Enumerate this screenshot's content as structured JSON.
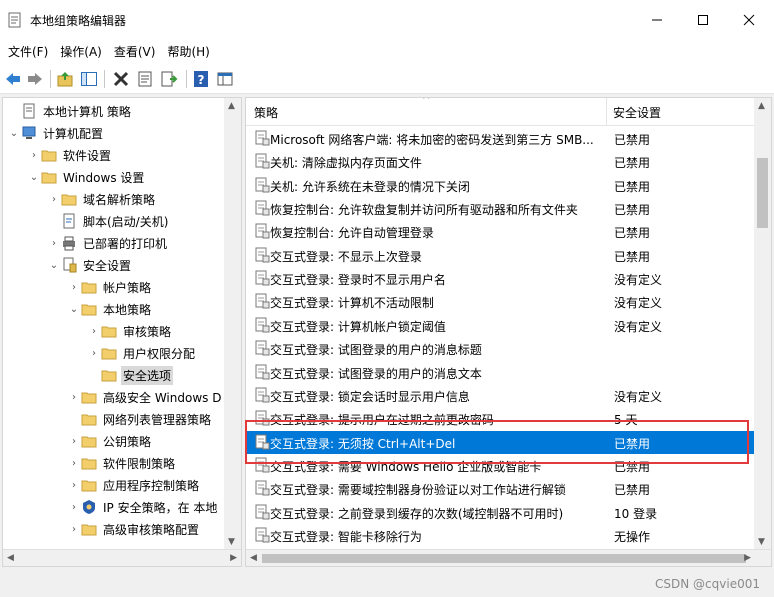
{
  "window": {
    "title": "本地组策略编辑器",
    "icon": "policy-editor-icon"
  },
  "menu": [
    "文件(F)",
    "操作(A)",
    "查看(V)",
    "帮助(H)"
  ],
  "toolbar_icons": [
    "back-arrow-icon",
    "forward-arrow-icon",
    "up-folder-icon",
    "show-hide-tree-icon",
    "delete-icon",
    "properties-icon",
    "export-list-icon",
    "help-icon",
    "view-icon"
  ],
  "tree": [
    {
      "label": "本地计算机 策略",
      "icon": "policy-doc-icon",
      "arrow": ""
    },
    {
      "label": "计算机配置",
      "icon": "computer-icon",
      "arrow": "⌄"
    },
    {
      "label": "软件设置",
      "icon": "folder-icon",
      "arrow": "›"
    },
    {
      "label": "Windows 设置",
      "icon": "folder-icon",
      "arrow": "⌄"
    },
    {
      "label": "域名解析策略",
      "icon": "folder-icon",
      "arrow": "›"
    },
    {
      "label": "脚本(启动/关机)",
      "icon": "script-icon",
      "arrow": ""
    },
    {
      "label": "已部署的打印机",
      "icon": "printer-icon",
      "arrow": "›"
    },
    {
      "label": "安全设置",
      "icon": "security-icon",
      "arrow": "⌄"
    },
    {
      "label": "帐户策略",
      "icon": "folder-icon",
      "arrow": "›"
    },
    {
      "label": "本地策略",
      "icon": "folder-icon",
      "arrow": "⌄"
    },
    {
      "label": "审核策略",
      "icon": "folder-icon",
      "arrow": "›"
    },
    {
      "label": "用户权限分配",
      "icon": "folder-icon",
      "arrow": "›"
    },
    {
      "label": "安全选项",
      "icon": "folder-icon",
      "arrow": ""
    },
    {
      "label": "高级安全 Windows D",
      "icon": "folder-icon",
      "arrow": "›"
    },
    {
      "label": "网络列表管理器策略",
      "icon": "folder-icon",
      "arrow": ""
    },
    {
      "label": "公钥策略",
      "icon": "folder-icon",
      "arrow": "›"
    },
    {
      "label": "软件限制策略",
      "icon": "folder-icon",
      "arrow": "›"
    },
    {
      "label": "应用程序控制策略",
      "icon": "folder-icon",
      "arrow": "›"
    },
    {
      "label": "IP 安全策略，在 本地",
      "icon": "ip-security-icon",
      "arrow": "›"
    },
    {
      "label": "高级审核策略配置",
      "icon": "folder-icon",
      "arrow": "›"
    }
  ],
  "tree_selected": "安全选项",
  "columns": {
    "policy": "策略",
    "setting": "安全设置"
  },
  "rows": [
    {
      "name": "Microsoft 网络客户端: 将未加密的密码发送到第三方 SMB...",
      "value": "已禁用"
    },
    {
      "name": "关机: 清除虚拟内存页面文件",
      "value": "已禁用"
    },
    {
      "name": "关机: 允许系统在未登录的情况下关闭",
      "value": "已禁用"
    },
    {
      "name": "恢复控制台: 允许软盘复制并访问所有驱动器和所有文件夹",
      "value": "已禁用"
    },
    {
      "name": "恢复控制台: 允许自动管理登录",
      "value": "已禁用"
    },
    {
      "name": "交互式登录: 不显示上次登录",
      "value": "已禁用"
    },
    {
      "name": "交互式登录: 登录时不显示用户名",
      "value": "没有定义"
    },
    {
      "name": "交互式登录: 计算机不活动限制",
      "value": "没有定义"
    },
    {
      "name": "交互式登录: 计算机帐户锁定阈值",
      "value": "没有定义"
    },
    {
      "name": "交互式登录: 试图登录的用户的消息标题",
      "value": ""
    },
    {
      "name": "交互式登录: 试图登录的用户的消息文本",
      "value": ""
    },
    {
      "name": "交互式登录: 锁定会话时显示用户信息",
      "value": "没有定义"
    },
    {
      "name": "交互式登录: 提示用户在过期之前更改密码",
      "value": "5 天"
    },
    {
      "name": "交互式登录: 无须按 Ctrl+Alt+Del",
      "value": "已禁用"
    },
    {
      "name": "交互式登录: 需要 Windows Hello 企业版或智能卡",
      "value": "已禁用"
    },
    {
      "name": "交互式登录: 需要域控制器身份验证以对工作站进行解锁",
      "value": "已禁用"
    },
    {
      "name": "交互式登录: 之前登录到缓存的次数(域控制器不可用时)",
      "value": "10 登录"
    },
    {
      "name": "交互式登录: 智能卡移除行为",
      "value": "无操作"
    }
  ],
  "selected_row": "交互式登录: 无须按 Ctrl+Alt+Del",
  "watermark": "CSDN @cqvie001",
  "colors": {
    "selection": "#0078d7",
    "highlight_box": "#e23a3a"
  }
}
